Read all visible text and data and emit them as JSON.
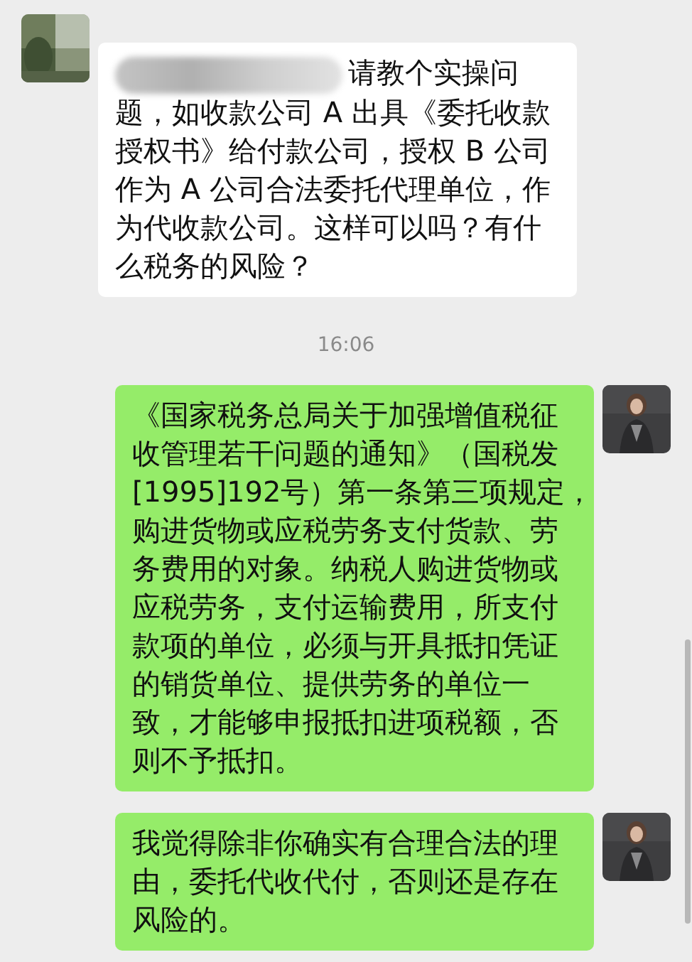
{
  "messages": [
    {
      "kind": "incoming",
      "redacted_mention": true,
      "lines": [
        "请教个实操问",
        "题，如收款公司 A 出具《委托收款",
        "授权书》给付款公司，授权 B 公司",
        "作为 A 公司合法委托代理单位，作",
        "为代收款公司。这样可以吗？有什",
        "么税务的风险？"
      ]
    },
    {
      "kind": "time",
      "text": "16:06"
    },
    {
      "kind": "outgoing",
      "lines": [
        "《国家税务总局关于加强增值税征",
        "收管理若干问题的通知》（国税发",
        "[1995]192号）第一条第三项规定，",
        "购进货物或应税劳务支付货款、劳",
        "务费用的对象。纳税人购进货物或",
        "应税劳务，支付运输费用，所支付",
        "款项的单位，必须与开具抵扣凭证",
        "的销货单位、提供劳务的单位一",
        "致，才能够申报抵扣进项税额，否",
        "则不予抵扣。"
      ]
    },
    {
      "kind": "outgoing",
      "lines": [
        "我觉得除非你确实有合理合法的理",
        "由，委托代收代付，否则还是存在",
        "风险的。"
      ]
    }
  ]
}
